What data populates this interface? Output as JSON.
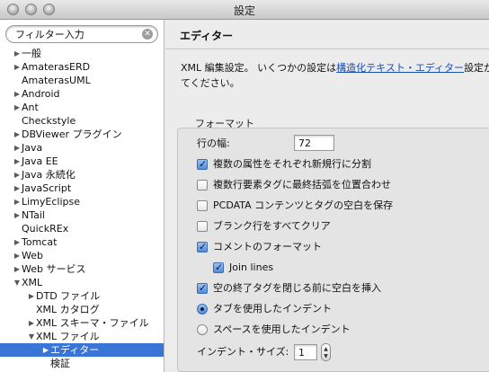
{
  "window": {
    "title": "設定"
  },
  "sidebar": {
    "filter_value": "フィルター入力",
    "items": [
      {
        "label": "一般",
        "arrow": "▶"
      },
      {
        "label": "AmaterasERD",
        "arrow": "▶"
      },
      {
        "label": "AmaterasUML",
        "arrow": ""
      },
      {
        "label": "Android",
        "arrow": "▶"
      },
      {
        "label": "Ant",
        "arrow": "▶"
      },
      {
        "label": "Checkstyle",
        "arrow": ""
      },
      {
        "label": "DBViewer プラグイン",
        "arrow": "▶"
      },
      {
        "label": "Java",
        "arrow": "▶"
      },
      {
        "label": "Java EE",
        "arrow": "▶"
      },
      {
        "label": "Java 永続化",
        "arrow": "▶"
      },
      {
        "label": "JavaScript",
        "arrow": "▶"
      },
      {
        "label": "LimyEclipse",
        "arrow": "▶"
      },
      {
        "label": "NTail",
        "arrow": "▶"
      },
      {
        "label": "QuickREx",
        "arrow": ""
      },
      {
        "label": "Tomcat",
        "arrow": "▶"
      },
      {
        "label": "Web",
        "arrow": "▶"
      },
      {
        "label": "Web サービス",
        "arrow": "▶"
      },
      {
        "label": "XML",
        "arrow": "▼"
      },
      {
        "label": "DTD ファイル",
        "arrow": "▶"
      },
      {
        "label": "XML カタログ",
        "arrow": ""
      },
      {
        "label": "XML スキーマ・ファイル",
        "arrow": "▶"
      },
      {
        "label": "XML ファイル",
        "arrow": "▼"
      },
      {
        "label": "エディター",
        "arrow": "▶"
      },
      {
        "label": "検証",
        "arrow": ""
      }
    ]
  },
  "main": {
    "heading": "エディター",
    "desc_prefix": "XML 編集設定。 いくつかの設定は",
    "desc_link": "構造化テキスト・エディター",
    "desc_suffix": "設定か",
    "desc_line2": "てください。",
    "group_label": "フォーマット",
    "line_width_label": "行の幅:",
    "line_width_value": "72",
    "options": {
      "split_attrs": "複数の属性をそれぞれ新規行に分割",
      "align_bracket": "複数行要素タグに最終括弧を位置合わせ",
      "preserve_pcdata": "PCDATA コンテンツとタグの空白を保存",
      "clear_blank": "ブランク行をすべてクリア",
      "format_comments": "コメントのフォーマット",
      "join_lines": "Join lines",
      "space_before_close": "空の終了タグを閉じる前に空白を挿入",
      "indent_tabs": "タブを使用したインデント",
      "indent_spaces": "スペースを使用したインデント"
    },
    "indent_size_label": "インデント・サイズ:",
    "indent_size_value": "1"
  }
}
